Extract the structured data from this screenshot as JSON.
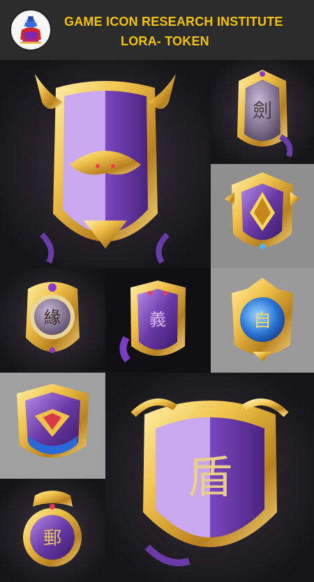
{
  "header": {
    "title_line1": "GAME ICON RESEARCH INSTITUTE",
    "title_line2": "LORA- TOKEN"
  },
  "icons": {
    "logo": "potion-bottle-icon",
    "emblems": [
      "purple-phoenix-shield-emblem",
      "glyph-medallion-emblem",
      "gold-star-crest-emblem",
      "round-glyph-badge-emblem",
      "purple-demon-crest-emblem",
      "blue-orb-badge-emblem",
      "winged-purple-blue-crest-emblem",
      "purple-ornate-medal-emblem",
      "large-purple-glyph-shield-emblem"
    ]
  },
  "colors": {
    "accent_gold": "#f4c400",
    "purple": "#6a3aa8",
    "panel_dark": "#1b1b1d",
    "panel_gray": "#8e8e8e"
  }
}
